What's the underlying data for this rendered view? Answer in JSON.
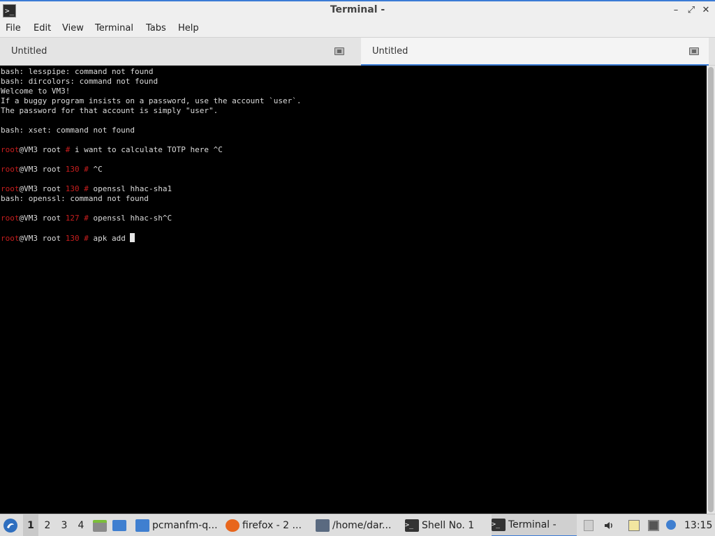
{
  "window": {
    "title": "Terminal -",
    "minimize_glyph": "–",
    "maximize_glyph": "⤢",
    "close_glyph": "✕"
  },
  "menubar": {
    "items": [
      "File",
      "Edit",
      "View",
      "Terminal",
      "Tabs",
      "Help"
    ]
  },
  "tabs": [
    {
      "label": "Untitled",
      "active": false
    },
    {
      "label": "Untitled",
      "active": true
    }
  ],
  "terminal": {
    "lines": [
      {
        "text": "bash: lesspipe: command not found"
      },
      {
        "text": "bash: dircolors: command not found"
      },
      {
        "text": "Welcome to VM3!"
      },
      {
        "text": "If a buggy program insists on a password, use the account `user`."
      },
      {
        "text": "The password for that account is simply \"user\"."
      },
      {
        "text": ""
      },
      {
        "text": "bash: xset: command not found"
      },
      {
        "text": ""
      },
      {
        "prompt": true,
        "user": "root",
        "host_path": "@VM3 root ",
        "code": "",
        "hash": "# ",
        "cmd": "i want to calculate TOTP here ^C"
      },
      {
        "text": ""
      },
      {
        "prompt": true,
        "user": "root",
        "host_path": "@VM3 root ",
        "code": "130 ",
        "hash": "# ",
        "cmd": "^C"
      },
      {
        "text": ""
      },
      {
        "prompt": true,
        "user": "root",
        "host_path": "@VM3 root ",
        "code": "130 ",
        "hash": "# ",
        "cmd": "openssl hhac-sha1"
      },
      {
        "text": "bash: openssl: command not found"
      },
      {
        "text": ""
      },
      {
        "prompt": true,
        "user": "root",
        "host_path": "@VM3 root ",
        "code": "127 ",
        "hash": "# ",
        "cmd": "openssl hhac-sh^C"
      },
      {
        "text": ""
      },
      {
        "prompt": true,
        "user": "root",
        "host_path": "@VM3 root ",
        "code": "130 ",
        "hash": "# ",
        "cmd": "apk add ",
        "cursor": true
      }
    ]
  },
  "taskbar": {
    "workspaces": [
      "1",
      "2",
      "3",
      "4"
    ],
    "active_workspace": "1",
    "tasks": [
      {
        "label": "pcmanfm-q...",
        "icon": "folder-icon",
        "color": "#3f7fd0"
      },
      {
        "label": "firefox - 2 ...",
        "icon": "firefox-icon",
        "color": "#e8661c"
      },
      {
        "label": "/home/dar...",
        "icon": "editor-icon",
        "color": "#5a6a80"
      },
      {
        "label": "Shell No. 1",
        "icon": "shell-icon",
        "color": "#333333"
      },
      {
        "label": "Terminal -",
        "icon": "terminal-icon",
        "color": "#333333",
        "active": true
      }
    ],
    "clock": "13:15"
  },
  "colors": {
    "accent": "#3a7bd5",
    "prompt_red": "#c81e1e",
    "terminal_bg": "#000000",
    "terminal_fg": "#dcdcdc"
  }
}
